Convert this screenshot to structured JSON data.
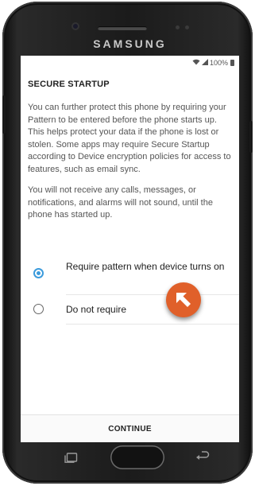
{
  "device": {
    "brand": "SAMSUNG"
  },
  "statusbar": {
    "battery_text": "100%",
    "icons": [
      "wifi-icon",
      "signal-icon",
      "battery-icon"
    ]
  },
  "page": {
    "title": "SECURE STARTUP",
    "paragraph1": "You can further protect this phone by requiring your Pattern to be entered before the phone starts up. This helps protect your data if the phone is lost or stolen. Some apps may require Secure Startup according to Device encryption policies for access to features, such as email sync.",
    "paragraph2": "You will not receive any calls, messages, or notifications, and alarms will not sound, until the phone has started up."
  },
  "options": [
    {
      "label": "Require pattern when device turns on",
      "selected": true
    },
    {
      "label": "Do not require",
      "selected": false
    }
  ],
  "footer": {
    "continue_label": "CONTINUE"
  },
  "colors": {
    "accent": "#3c9bdc",
    "pointer": "#e0602a"
  }
}
